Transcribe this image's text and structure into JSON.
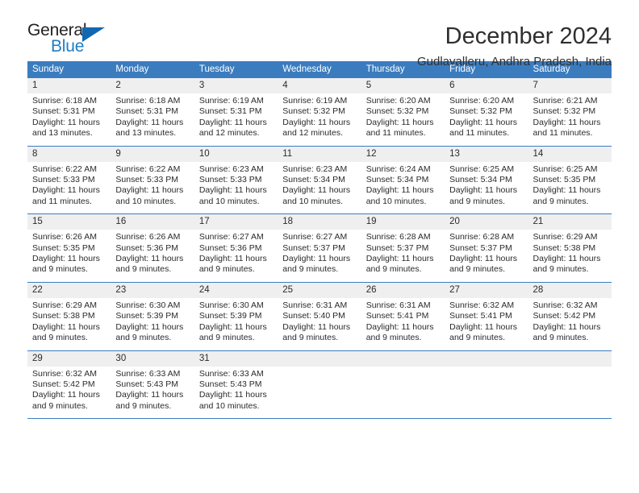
{
  "logo": {
    "word_one": "General",
    "word_two": "Blue",
    "triangle_color": "#1267b1",
    "blue_color": "#1f7ec4"
  },
  "header": {
    "title": "December 2024",
    "location": "Gudlavalleru, Andhra Pradesh, India"
  },
  "theme": {
    "header_blue": "#3b7cbf",
    "daynum_band": "#efefef",
    "text": "#2b2b2b"
  },
  "calendar": {
    "weekdays": [
      "Sunday",
      "Monday",
      "Tuesday",
      "Wednesday",
      "Thursday",
      "Friday",
      "Saturday"
    ],
    "weeks": [
      {
        "days": [
          {
            "num": "1",
            "l1": "Sunrise: 6:18 AM",
            "l2": "Sunset: 5:31 PM",
            "l3": "Daylight: 11 hours",
            "l4": "and 13 minutes."
          },
          {
            "num": "2",
            "l1": "Sunrise: 6:18 AM",
            "l2": "Sunset: 5:31 PM",
            "l3": "Daylight: 11 hours",
            "l4": "and 13 minutes."
          },
          {
            "num": "3",
            "l1": "Sunrise: 6:19 AM",
            "l2": "Sunset: 5:31 PM",
            "l3": "Daylight: 11 hours",
            "l4": "and 12 minutes."
          },
          {
            "num": "4",
            "l1": "Sunrise: 6:19 AM",
            "l2": "Sunset: 5:32 PM",
            "l3": "Daylight: 11 hours",
            "l4": "and 12 minutes."
          },
          {
            "num": "5",
            "l1": "Sunrise: 6:20 AM",
            "l2": "Sunset: 5:32 PM",
            "l3": "Daylight: 11 hours",
            "l4": "and 11 minutes."
          },
          {
            "num": "6",
            "l1": "Sunrise: 6:20 AM",
            "l2": "Sunset: 5:32 PM",
            "l3": "Daylight: 11 hours",
            "l4": "and 11 minutes."
          },
          {
            "num": "7",
            "l1": "Sunrise: 6:21 AM",
            "l2": "Sunset: 5:32 PM",
            "l3": "Daylight: 11 hours",
            "l4": "and 11 minutes."
          }
        ]
      },
      {
        "days": [
          {
            "num": "8",
            "l1": "Sunrise: 6:22 AM",
            "l2": "Sunset: 5:33 PM",
            "l3": "Daylight: 11 hours",
            "l4": "and 11 minutes."
          },
          {
            "num": "9",
            "l1": "Sunrise: 6:22 AM",
            "l2": "Sunset: 5:33 PM",
            "l3": "Daylight: 11 hours",
            "l4": "and 10 minutes."
          },
          {
            "num": "10",
            "l1": "Sunrise: 6:23 AM",
            "l2": "Sunset: 5:33 PM",
            "l3": "Daylight: 11 hours",
            "l4": "and 10 minutes."
          },
          {
            "num": "11",
            "l1": "Sunrise: 6:23 AM",
            "l2": "Sunset: 5:34 PM",
            "l3": "Daylight: 11 hours",
            "l4": "and 10 minutes."
          },
          {
            "num": "12",
            "l1": "Sunrise: 6:24 AM",
            "l2": "Sunset: 5:34 PM",
            "l3": "Daylight: 11 hours",
            "l4": "and 10 minutes."
          },
          {
            "num": "13",
            "l1": "Sunrise: 6:25 AM",
            "l2": "Sunset: 5:34 PM",
            "l3": "Daylight: 11 hours",
            "l4": "and 9 minutes."
          },
          {
            "num": "14",
            "l1": "Sunrise: 6:25 AM",
            "l2": "Sunset: 5:35 PM",
            "l3": "Daylight: 11 hours",
            "l4": "and 9 minutes."
          }
        ]
      },
      {
        "days": [
          {
            "num": "15",
            "l1": "Sunrise: 6:26 AM",
            "l2": "Sunset: 5:35 PM",
            "l3": "Daylight: 11 hours",
            "l4": "and 9 minutes."
          },
          {
            "num": "16",
            "l1": "Sunrise: 6:26 AM",
            "l2": "Sunset: 5:36 PM",
            "l3": "Daylight: 11 hours",
            "l4": "and 9 minutes."
          },
          {
            "num": "17",
            "l1": "Sunrise: 6:27 AM",
            "l2": "Sunset: 5:36 PM",
            "l3": "Daylight: 11 hours",
            "l4": "and 9 minutes."
          },
          {
            "num": "18",
            "l1": "Sunrise: 6:27 AM",
            "l2": "Sunset: 5:37 PM",
            "l3": "Daylight: 11 hours",
            "l4": "and 9 minutes."
          },
          {
            "num": "19",
            "l1": "Sunrise: 6:28 AM",
            "l2": "Sunset: 5:37 PM",
            "l3": "Daylight: 11 hours",
            "l4": "and 9 minutes."
          },
          {
            "num": "20",
            "l1": "Sunrise: 6:28 AM",
            "l2": "Sunset: 5:37 PM",
            "l3": "Daylight: 11 hours",
            "l4": "and 9 minutes."
          },
          {
            "num": "21",
            "l1": "Sunrise: 6:29 AM",
            "l2": "Sunset: 5:38 PM",
            "l3": "Daylight: 11 hours",
            "l4": "and 9 minutes."
          }
        ]
      },
      {
        "days": [
          {
            "num": "22",
            "l1": "Sunrise: 6:29 AM",
            "l2": "Sunset: 5:38 PM",
            "l3": "Daylight: 11 hours",
            "l4": "and 9 minutes."
          },
          {
            "num": "23",
            "l1": "Sunrise: 6:30 AM",
            "l2": "Sunset: 5:39 PM",
            "l3": "Daylight: 11 hours",
            "l4": "and 9 minutes."
          },
          {
            "num": "24",
            "l1": "Sunrise: 6:30 AM",
            "l2": "Sunset: 5:39 PM",
            "l3": "Daylight: 11 hours",
            "l4": "and 9 minutes."
          },
          {
            "num": "25",
            "l1": "Sunrise: 6:31 AM",
            "l2": "Sunset: 5:40 PM",
            "l3": "Daylight: 11 hours",
            "l4": "and 9 minutes."
          },
          {
            "num": "26",
            "l1": "Sunrise: 6:31 AM",
            "l2": "Sunset: 5:41 PM",
            "l3": "Daylight: 11 hours",
            "l4": "and 9 minutes."
          },
          {
            "num": "27",
            "l1": "Sunrise: 6:32 AM",
            "l2": "Sunset: 5:41 PM",
            "l3": "Daylight: 11 hours",
            "l4": "and 9 minutes."
          },
          {
            "num": "28",
            "l1": "Sunrise: 6:32 AM",
            "l2": "Sunset: 5:42 PM",
            "l3": "Daylight: 11 hours",
            "l4": "and 9 minutes."
          }
        ]
      },
      {
        "days": [
          {
            "num": "29",
            "l1": "Sunrise: 6:32 AM",
            "l2": "Sunset: 5:42 PM",
            "l3": "Daylight: 11 hours",
            "l4": "and 9 minutes."
          },
          {
            "num": "30",
            "l1": "Sunrise: 6:33 AM",
            "l2": "Sunset: 5:43 PM",
            "l3": "Daylight: 11 hours",
            "l4": "and 9 minutes."
          },
          {
            "num": "31",
            "l1": "Sunrise: 6:33 AM",
            "l2": "Sunset: 5:43 PM",
            "l3": "Daylight: 11 hours",
            "l4": "and 10 minutes."
          },
          {
            "num": "",
            "l1": "",
            "l2": "",
            "l3": "",
            "l4": ""
          },
          {
            "num": "",
            "l1": "",
            "l2": "",
            "l3": "",
            "l4": ""
          },
          {
            "num": "",
            "l1": "",
            "l2": "",
            "l3": "",
            "l4": ""
          },
          {
            "num": "",
            "l1": "",
            "l2": "",
            "l3": "",
            "l4": ""
          }
        ]
      }
    ]
  }
}
